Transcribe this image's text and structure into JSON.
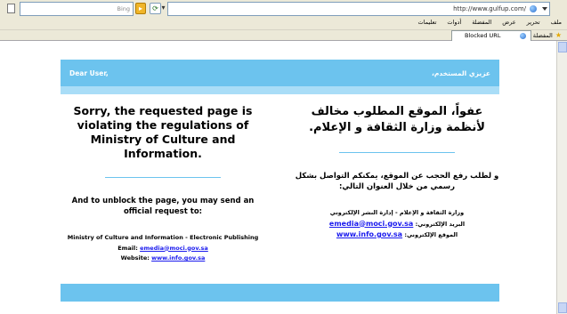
{
  "browser": {
    "url": "http://www.gulfup.com/",
    "search_placeholder": "Bing",
    "search_go": "▸",
    "menu": [
      "ملف",
      "تحرير",
      "عرض",
      "المفضلة",
      "أدوات",
      "تعليمات"
    ],
    "favorites_label": "المفضلة",
    "tab_title": "Blocked URL"
  },
  "page": {
    "greeting_en": "Dear User,",
    "greeting_ar": "عزيزي المستخدم،",
    "en": {
      "headline": "Sorry, the requested page is violating the regulations of Ministry of Culture and Information.",
      "sub": "And to unblock the page, you may send an official request to:",
      "org": "Ministry of Culture and Information - Electronic Publishing",
      "email_label": "Email:",
      "email": "emedia@moci.gov.sa",
      "website_label": "Website:",
      "website": "www.info.gov.sa"
    },
    "ar": {
      "headline": "عفواً، الموقع المطلوب مخالف لأنظمة وزارة الثقافة و الإعلام.",
      "sub": "و لطلب رفع الحجب عن الموقع، يمكنكم التواصل بشكل رسمي من خلال العنوان التالي:",
      "org": "وزارة الثقافة و الإعلام - إدارة النشر الإلكتروني",
      "email_label": "البريد الإلكتروني:",
      "email": "emedia@moci.gov.sa",
      "website_label": "الموقع الإلكتروني:",
      "website": "www.info.gov.sa"
    }
  },
  "colors": {
    "band": "#6cc3ee",
    "stripe": "#a9ddf7",
    "link": "#1a1aee"
  }
}
